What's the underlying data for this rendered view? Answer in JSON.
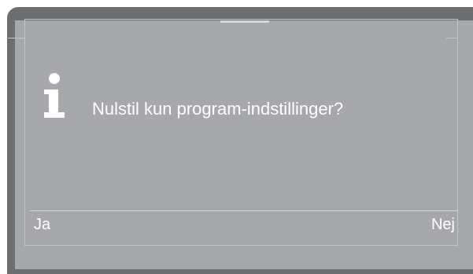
{
  "dialog": {
    "message": "Nulstil kun program-indstillinger?",
    "icon": "info-icon"
  },
  "softkeys": {
    "left_label": "Ja",
    "right_label": "Nej"
  },
  "colors": {
    "bezel": "#6d6e70",
    "screen": "#a6a8ab",
    "text": "#ffffff"
  }
}
